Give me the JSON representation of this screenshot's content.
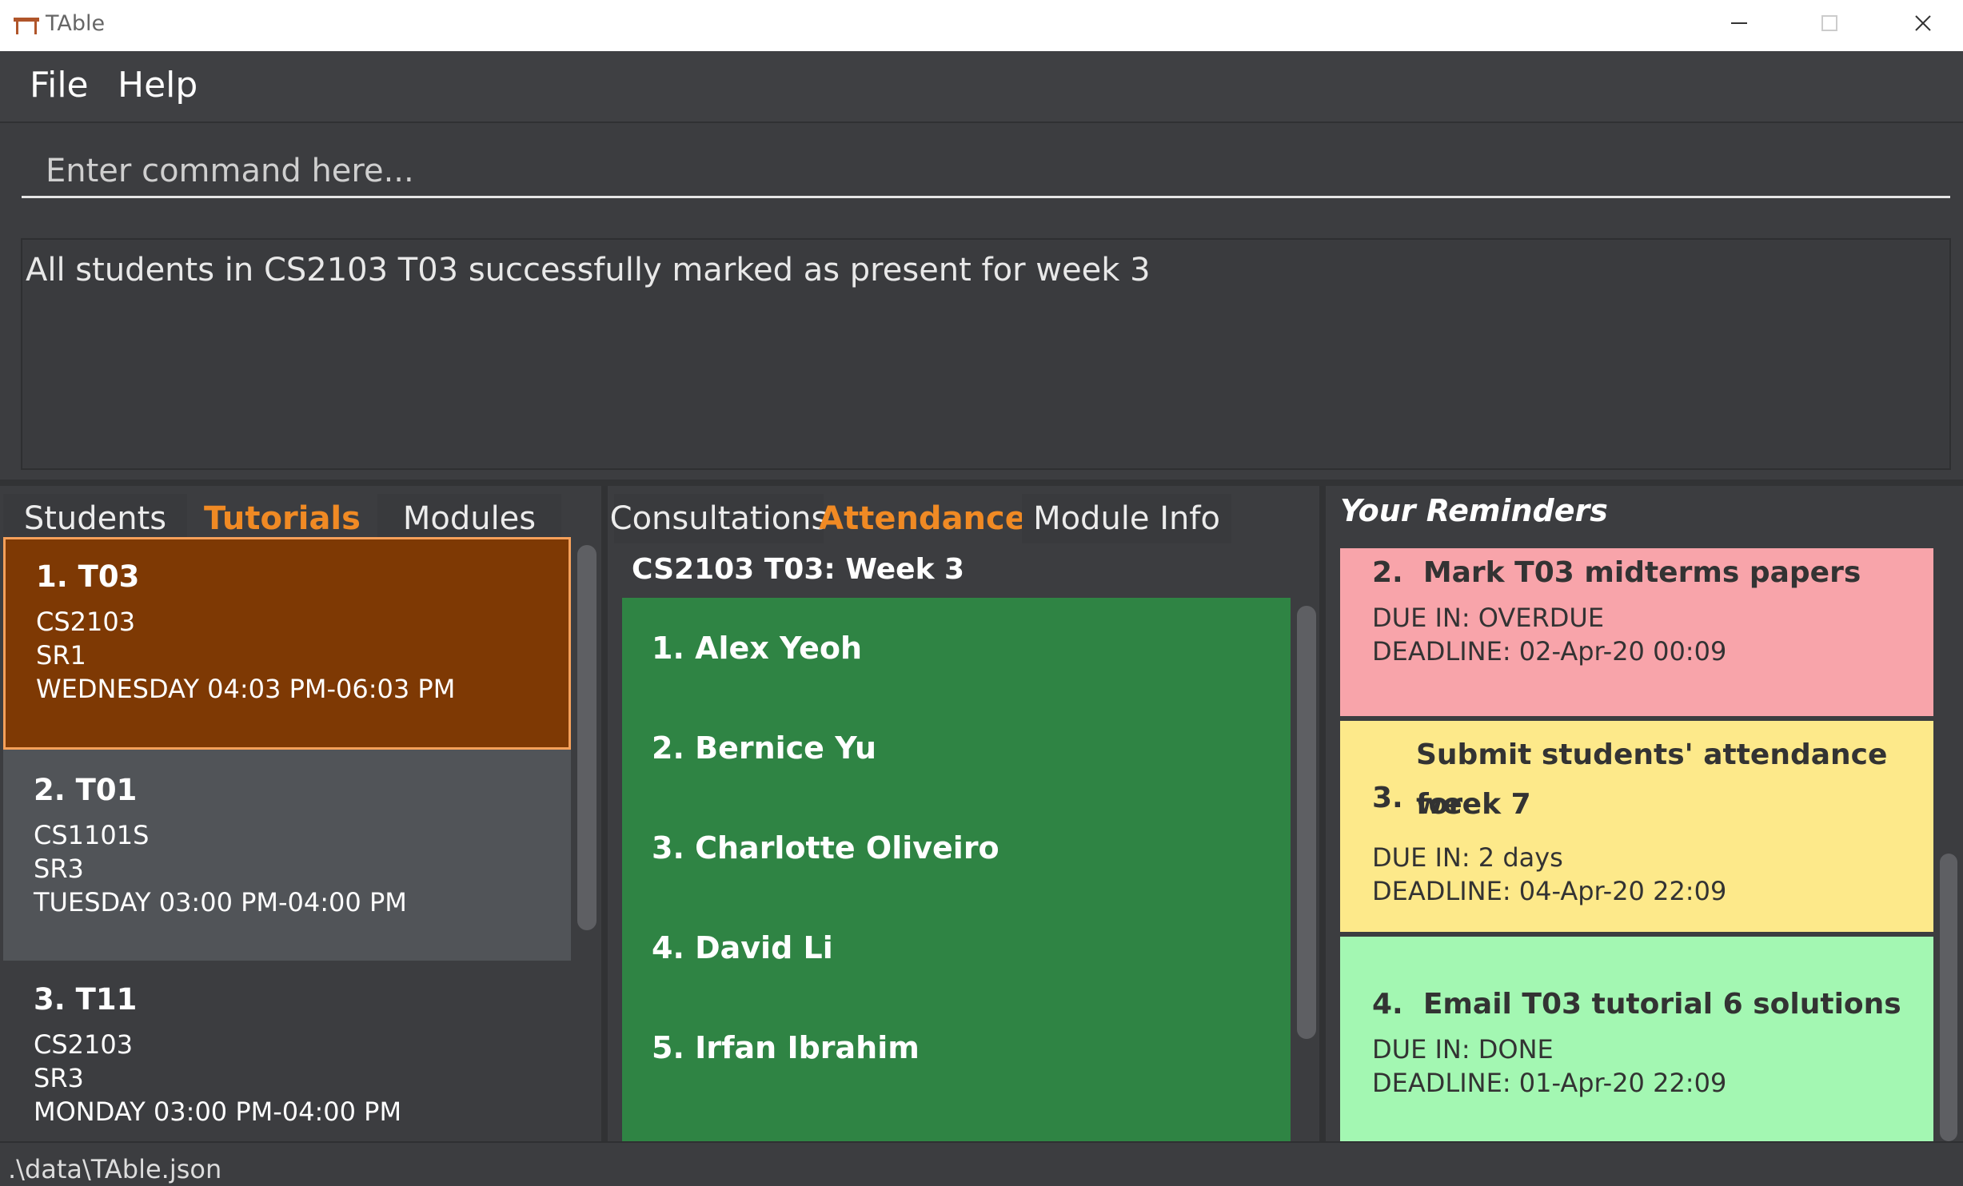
{
  "window": {
    "title": "TAble"
  },
  "menu": {
    "file": "File",
    "help": "Help"
  },
  "command": {
    "placeholder": "Enter command here..."
  },
  "result": {
    "text": "All students in CS2103 T03 successfully marked as present for week 3"
  },
  "left": {
    "tabs": [
      "Students",
      "Tutorials",
      "Modules"
    ],
    "active_tab": "Tutorials",
    "tutorials": [
      {
        "title": "1.  T03",
        "module": "CS2103",
        "venue": "SR1",
        "time": "WEDNESDAY 04:03 PM-06:03 PM"
      },
      {
        "title": "2.  T01",
        "module": "CS1101S",
        "venue": "SR3",
        "time": "TUESDAY 03:00 PM-04:00 PM"
      },
      {
        "title": "3.  T11",
        "module": "CS2103",
        "venue": "SR3",
        "time": "MONDAY 03:00 PM-04:00 PM"
      }
    ]
  },
  "middle": {
    "tabs": [
      "Consultations",
      "Attendance",
      "Module Info"
    ],
    "active_tab": "Attendance",
    "heading": "CS2103 T03: Week 3",
    "students": [
      "1.  Alex Yeoh",
      "2.  Bernice Yu",
      "3.  Charlotte Oliveiro",
      "4.  David Li",
      "5.  Irfan Ibrahim"
    ]
  },
  "right": {
    "heading": "Your Reminders",
    "reminders": [
      {
        "num": "2.",
        "title": "Mark T03 midterms papers",
        "due": "DUE IN: OVERDUE",
        "deadline": "DEADLINE: 02-Apr-20 00:09",
        "color": "#f8a4aa"
      },
      {
        "num": "3.",
        "title_line1": "Submit students' attendance for",
        "title_line2": "week 7",
        "due": "DUE IN: 2 days",
        "deadline": "DEADLINE: 04-Apr-20 22:09",
        "color": "#fde98a"
      },
      {
        "num": "4.",
        "title": "Email T03 tutorial 6 solutions",
        "due": "DUE IN: DONE",
        "deadline": "DEADLINE: 01-Apr-20 22:09",
        "color": "#a3f7b2"
      }
    ]
  },
  "status": {
    "path": ".\\data\\TAble.json"
  },
  "colors": {
    "accent": "#f08a24",
    "selected_card": "#7e3904",
    "selected_border": "#f5a05a",
    "attendance_bg": "#2f8444",
    "card_alt": "#515458"
  }
}
